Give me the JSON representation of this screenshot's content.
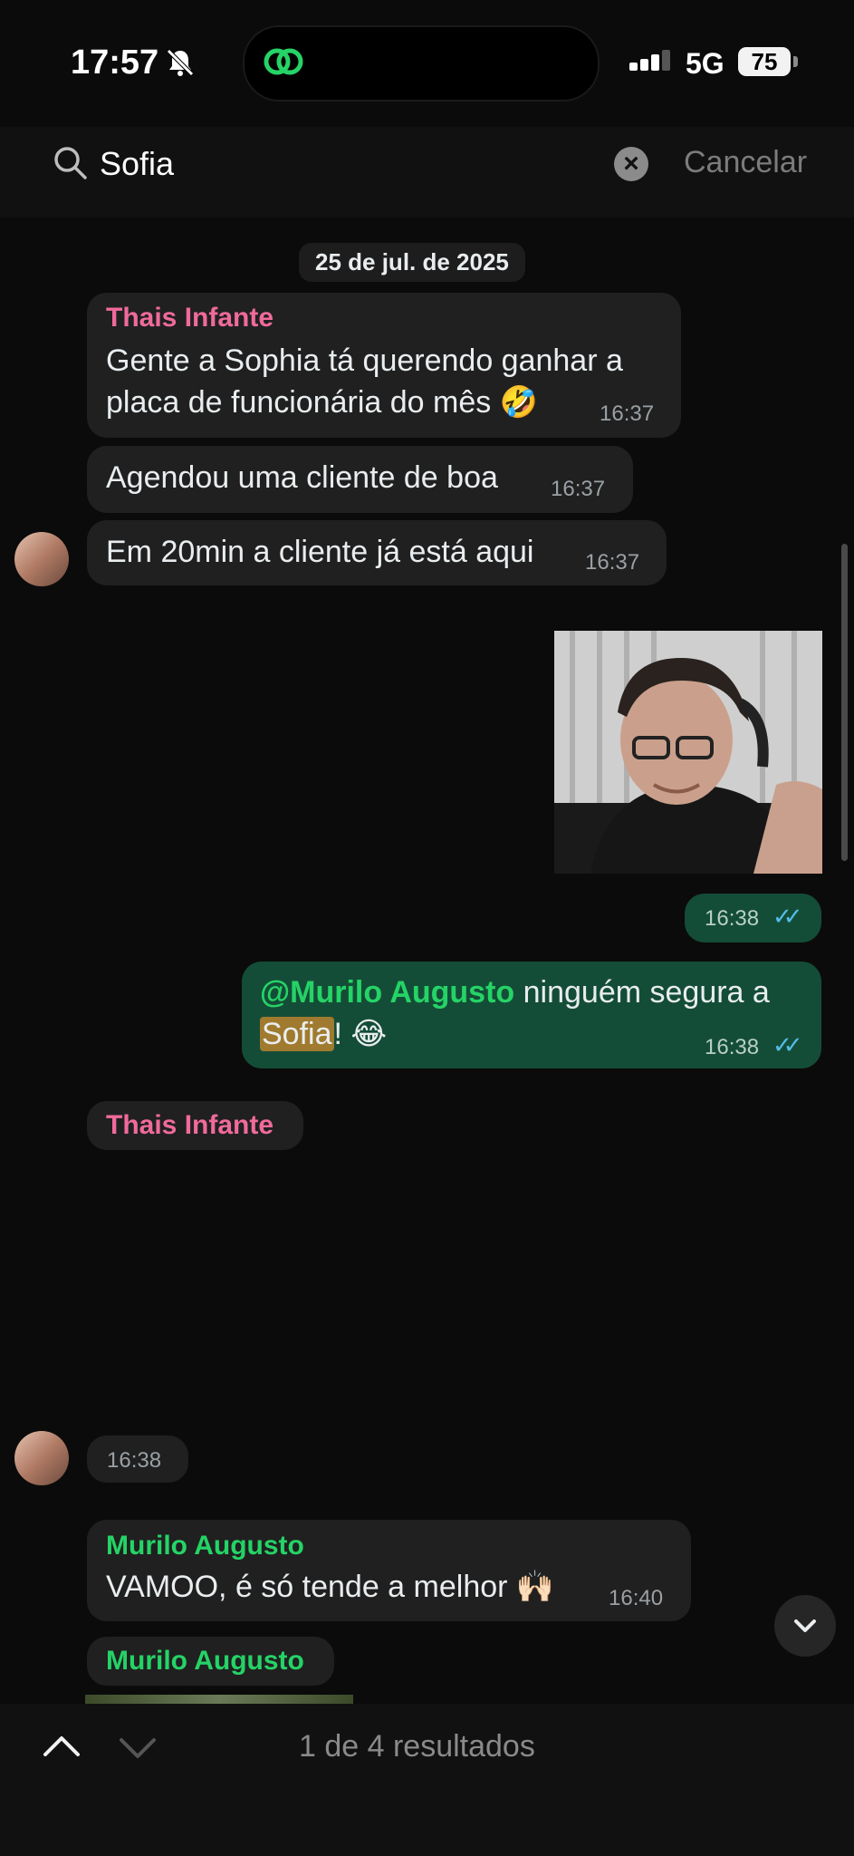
{
  "status_bar": {
    "time": "17:57",
    "network": "5G",
    "battery": "75"
  },
  "search": {
    "value": "Sofia",
    "cancel_label": "Cancelar"
  },
  "chat": {
    "date_chip": "25 de jul. de 2025",
    "messages": [
      {
        "sender": "Thais Infante",
        "line1": "Gente a Sophia tá querendo ganhar a",
        "line2": "placa de funcionária do mês 🤣",
        "time": "16:37"
      },
      {
        "text": "Agendou uma cliente de boa",
        "time": "16:37"
      },
      {
        "text": "Em 20min a cliente já está aqui",
        "time": "16:37"
      },
      {
        "time": "16:38"
      },
      {
        "mention": "Murilo Augusto",
        "text_after_mention": " ninguém segura a",
        "highlight": "Sofia",
        "text_end": "! 😂",
        "time": "16:38"
      },
      {
        "sender": "Thais Infante"
      },
      {
        "time": "16:38"
      },
      {
        "sender": "Murilo Augusto",
        "text": "VAMOO, é só tende a melhor 🙌🏻",
        "time": "16:40"
      },
      {
        "sender": "Murilo Augusto"
      }
    ],
    "mention_prefix": "@"
  },
  "bottom_bar": {
    "results_text": "1 de 4 resultados"
  },
  "colors": {
    "incoming_bubble": "#202020",
    "outgoing_bubble": "#144d37",
    "thais_name": "#f06a9b",
    "murilo_name": "#25d366",
    "read_ticks": "#53bdeb"
  }
}
